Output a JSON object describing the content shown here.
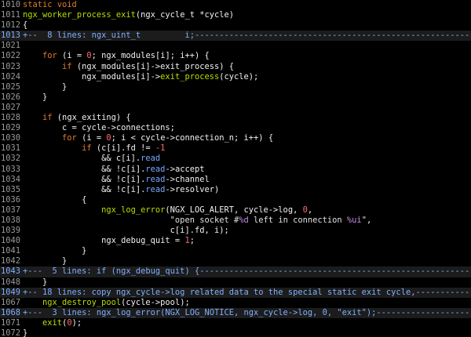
{
  "editor": {
    "lines": [
      {
        "n": "1010",
        "fold": false,
        "segs": [
          {
            "t": "static void",
            "c": "kw"
          }
        ]
      },
      {
        "n": "1011",
        "fold": false,
        "segs": [
          {
            "t": "ngx_worker_process_exit",
            "c": "fn"
          },
          {
            "t": "(ngx_cycle_t *cycle)",
            "c": ""
          }
        ]
      },
      {
        "n": "1012",
        "fold": false,
        "segs": [
          {
            "t": "{",
            "c": ""
          }
        ]
      },
      {
        "n": "1013",
        "fold": true,
        "segs": [
          {
            "t": "+--  8 lines: ngx_uint_t         i;---------------------------------------------------------------------",
            "c": ""
          }
        ]
      },
      {
        "n": "1021",
        "fold": false,
        "segs": [
          {
            "t": "",
            "c": ""
          }
        ]
      },
      {
        "n": "1022",
        "fold": false,
        "segs": [
          {
            "t": "    ",
            "c": ""
          },
          {
            "t": "for",
            "c": "kw"
          },
          {
            "t": " (i = ",
            "c": ""
          },
          {
            "t": "0",
            "c": "num"
          },
          {
            "t": "; ngx_modules[i]; i++) {",
            "c": ""
          }
        ]
      },
      {
        "n": "1023",
        "fold": false,
        "segs": [
          {
            "t": "        ",
            "c": ""
          },
          {
            "t": "if",
            "c": "kw"
          },
          {
            "t": " (ngx_modules[i]->exit_process) {",
            "c": ""
          }
        ]
      },
      {
        "n": "1024",
        "fold": false,
        "segs": [
          {
            "t": "            ngx_modules[i]->",
            "c": ""
          },
          {
            "t": "exit_process",
            "c": "fn"
          },
          {
            "t": "(cycle);",
            "c": ""
          }
        ]
      },
      {
        "n": "1025",
        "fold": false,
        "segs": [
          {
            "t": "        }",
            "c": ""
          }
        ]
      },
      {
        "n": "1026",
        "fold": false,
        "segs": [
          {
            "t": "    }",
            "c": ""
          }
        ]
      },
      {
        "n": "1027",
        "fold": false,
        "segs": [
          {
            "t": "",
            "c": ""
          }
        ]
      },
      {
        "n": "1028",
        "fold": false,
        "segs": [
          {
            "t": "    ",
            "c": ""
          },
          {
            "t": "if",
            "c": "kw"
          },
          {
            "t": " (ngx_exiting) {",
            "c": ""
          }
        ]
      },
      {
        "n": "1029",
        "fold": false,
        "segs": [
          {
            "t": "        c = cycle->connections;",
            "c": ""
          }
        ]
      },
      {
        "n": "1030",
        "fold": false,
        "segs": [
          {
            "t": "        ",
            "c": ""
          },
          {
            "t": "for",
            "c": "kw"
          },
          {
            "t": " (i = ",
            "c": ""
          },
          {
            "t": "0",
            "c": "num"
          },
          {
            "t": "; i < cycle->connection_n; i++) {",
            "c": ""
          }
        ]
      },
      {
        "n": "1031",
        "fold": false,
        "segs": [
          {
            "t": "            ",
            "c": ""
          },
          {
            "t": "if",
            "c": "kw"
          },
          {
            "t": " (c[i].fd != ",
            "c": ""
          },
          {
            "t": "-1",
            "c": "num"
          }
        ]
      },
      {
        "n": "1032",
        "fold": false,
        "segs": [
          {
            "t": "                && c[i].",
            "c": ""
          },
          {
            "t": "read",
            "c": "fld"
          }
        ]
      },
      {
        "n": "1033",
        "fold": false,
        "segs": [
          {
            "t": "                && !c[i].",
            "c": ""
          },
          {
            "t": "read",
            "c": "fld"
          },
          {
            "t": "->accept",
            "c": ""
          }
        ]
      },
      {
        "n": "1034",
        "fold": false,
        "segs": [
          {
            "t": "                && !c[i].",
            "c": ""
          },
          {
            "t": "read",
            "c": "fld"
          },
          {
            "t": "->channel",
            "c": ""
          }
        ]
      },
      {
        "n": "1035",
        "fold": false,
        "segs": [
          {
            "t": "                && !c[i].",
            "c": ""
          },
          {
            "t": "read",
            "c": "fld"
          },
          {
            "t": "->resolver)",
            "c": ""
          }
        ]
      },
      {
        "n": "1036",
        "fold": false,
        "segs": [
          {
            "t": "            {",
            "c": ""
          }
        ]
      },
      {
        "n": "1037",
        "fold": false,
        "segs": [
          {
            "t": "                ",
            "c": ""
          },
          {
            "t": "ngx_log_error",
            "c": "fn"
          },
          {
            "t": "(NGX_LOG_ALERT, cycle->log, ",
            "c": ""
          },
          {
            "t": "0",
            "c": "num"
          },
          {
            "t": ",",
            "c": ""
          }
        ]
      },
      {
        "n": "1038",
        "fold": false,
        "segs": [
          {
            "t": "                              ",
            "c": ""
          },
          {
            "t": "\"open socket #",
            "c": "str"
          },
          {
            "t": "%d",
            "c": "fmt"
          },
          {
            "t": " left in connection ",
            "c": "str"
          },
          {
            "t": "%ui",
            "c": "fmt"
          },
          {
            "t": "\"",
            "c": "str"
          },
          {
            "t": ",",
            "c": ""
          }
        ]
      },
      {
        "n": "1039",
        "fold": false,
        "segs": [
          {
            "t": "                              c[i].fd, i);",
            "c": ""
          }
        ]
      },
      {
        "n": "1040",
        "fold": false,
        "segs": [
          {
            "t": "                ngx_debug_quit = ",
            "c": ""
          },
          {
            "t": "1",
            "c": "num"
          },
          {
            "t": ";",
            "c": ""
          }
        ]
      },
      {
        "n": "1041",
        "fold": false,
        "segs": [
          {
            "t": "            }",
            "c": ""
          }
        ]
      },
      {
        "n": "1042",
        "fold": false,
        "segs": [
          {
            "t": "        }",
            "c": ""
          }
        ]
      },
      {
        "n": "1043",
        "fold": true,
        "segs": [
          {
            "t": "+---  5 lines: if (ngx_debug_quit) {------------------------------------------------------------------",
            "c": ""
          }
        ]
      },
      {
        "n": "1048",
        "fold": false,
        "segs": [
          {
            "t": "    }",
            "c": ""
          }
        ]
      },
      {
        "n": "1049",
        "fold": true,
        "segs": [
          {
            "t": "+-- 18 lines: copy ngx_cycle->log related data to the special static exit cycle,------------------------",
            "c": ""
          }
        ]
      },
      {
        "n": "1067",
        "fold": false,
        "segs": [
          {
            "t": "    ",
            "c": ""
          },
          {
            "t": "ngx_destroy_pool",
            "c": "fn"
          },
          {
            "t": "(cycle->pool);",
            "c": ""
          }
        ]
      },
      {
        "n": "1068",
        "fold": true,
        "segs": [
          {
            "t": "+---  3 lines: ngx_log_error(NGX_LOG_NOTICE, ngx_cycle->log, 0, \"exit\");-----------------------------",
            "c": ""
          }
        ]
      },
      {
        "n": "1071",
        "fold": false,
        "segs": [
          {
            "t": "    ",
            "c": ""
          },
          {
            "t": "exit",
            "c": "fn"
          },
          {
            "t": "(",
            "c": ""
          },
          {
            "t": "0",
            "c": "num"
          },
          {
            "t": ");",
            "c": ""
          }
        ]
      },
      {
        "n": "1072",
        "fold": false,
        "segs": [
          {
            "t": "}",
            "c": ""
          }
        ]
      }
    ]
  }
}
